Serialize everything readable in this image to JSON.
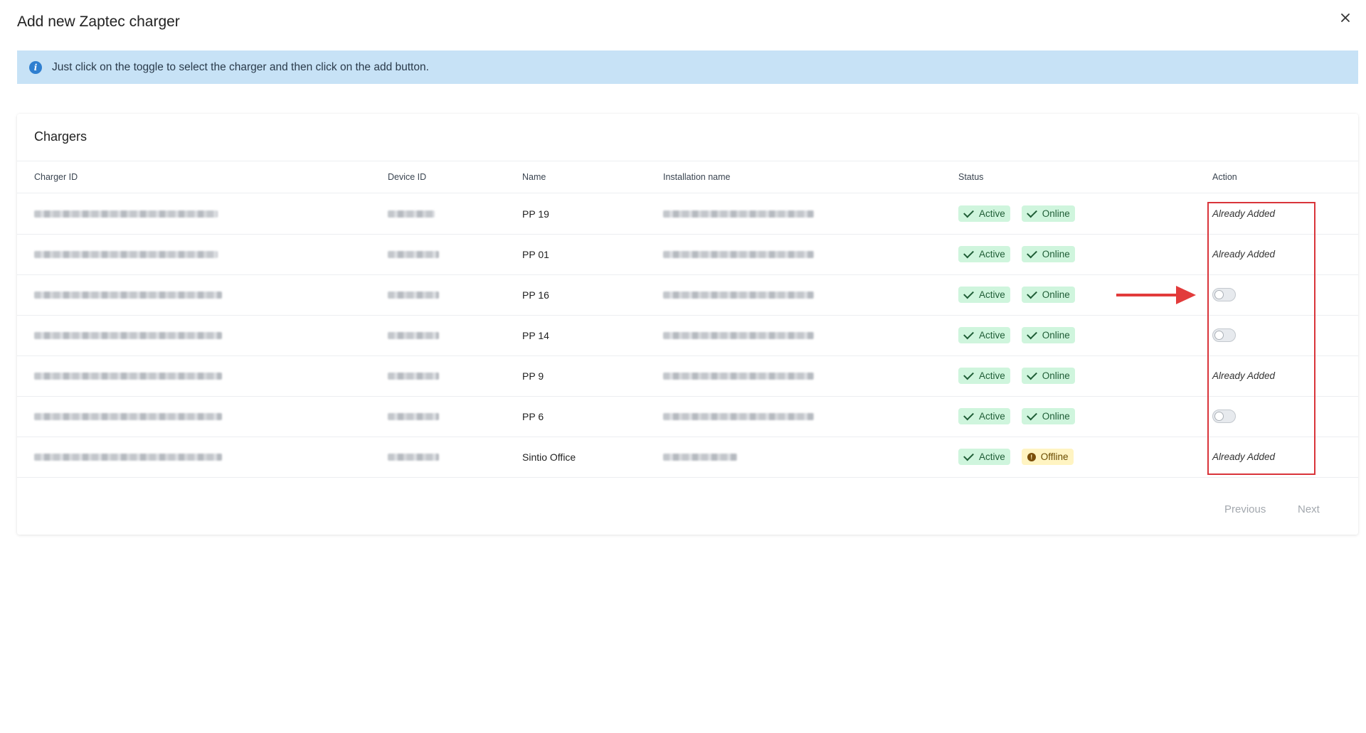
{
  "dialog": {
    "title": "Add new Zaptec charger",
    "close_icon": "close-icon"
  },
  "info": {
    "icon": "info-icon",
    "icon_glyph": "i",
    "text": "Just click on the toggle to select the charger and then click on the add button."
  },
  "chargers": {
    "title": "Chargers",
    "columns": [
      "Charger ID",
      "Device ID",
      "Name",
      "Installation name",
      "Status",
      "Action"
    ],
    "rows": [
      {
        "name": "PP 19",
        "status": "Active",
        "connectivity": "Online",
        "action": "already_added",
        "action_label": "Already Added"
      },
      {
        "name": "PP 01",
        "status": "Active",
        "connectivity": "Online",
        "action": "already_added",
        "action_label": "Already Added"
      },
      {
        "name": "PP 16",
        "status": "Active",
        "connectivity": "Online",
        "action": "toggle",
        "toggle_on": false
      },
      {
        "name": "PP 14",
        "status": "Active",
        "connectivity": "Online",
        "action": "toggle",
        "toggle_on": false
      },
      {
        "name": "PP 9",
        "status": "Active",
        "connectivity": "Online",
        "action": "already_added",
        "action_label": "Already Added"
      },
      {
        "name": "PP 6",
        "status": "Active",
        "connectivity": "Online",
        "action": "toggle",
        "toggle_on": false
      },
      {
        "name": "Sintio Office",
        "status": "Active",
        "connectivity": "Offline",
        "action": "already_added",
        "action_label": "Already Added"
      }
    ],
    "pagination": {
      "previous": "Previous",
      "next": "Next"
    }
  },
  "colors": {
    "banner_bg": "#c7e2f6",
    "badge_ok_bg": "#cff5dd",
    "badge_warn_bg": "#fff4c2",
    "annotation_red": "#d9343a"
  }
}
